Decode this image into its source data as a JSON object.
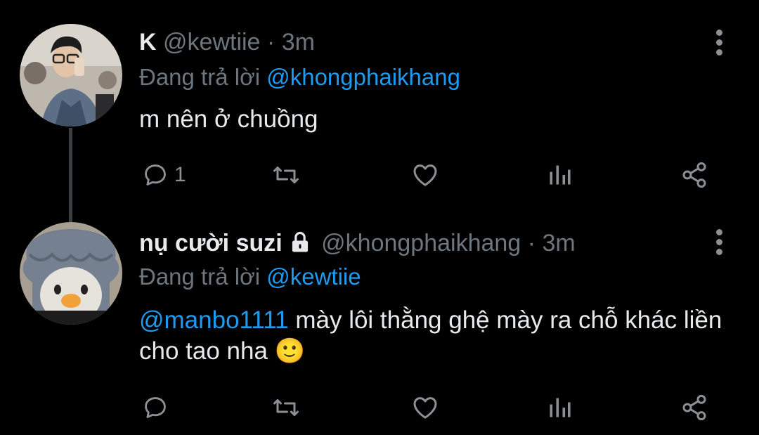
{
  "tweets": [
    {
      "name": "K",
      "handle": "@kewtiie",
      "separator": "·",
      "time": "3m",
      "replying_prefix": "Đang trả lời",
      "replying_to": "@khongphaikhang",
      "text": "m nên ở chuồng",
      "reply_count": "1",
      "avatar_icon": "profile-photo-man-glasses"
    },
    {
      "name": "nụ cười suzi",
      "protected": true,
      "handle": "@khongphaikhang",
      "separator": "·",
      "time": "3m",
      "replying_prefix": "Đang trả lời",
      "replying_to": "@kewtiie",
      "text_mention": "@manbo1111",
      "text": " mày lôi thằng ghệ mày ra chỗ khác liền cho tao nha",
      "emoji": "🙂",
      "reply_count": "",
      "avatar_icon": "profile-photo-duck-plush"
    }
  ],
  "colors": {
    "background": "#000000",
    "text": "#e7e9ea",
    "secondary": "#6e767d",
    "accent": "#1d9bf0",
    "icon": "#8b9095"
  }
}
